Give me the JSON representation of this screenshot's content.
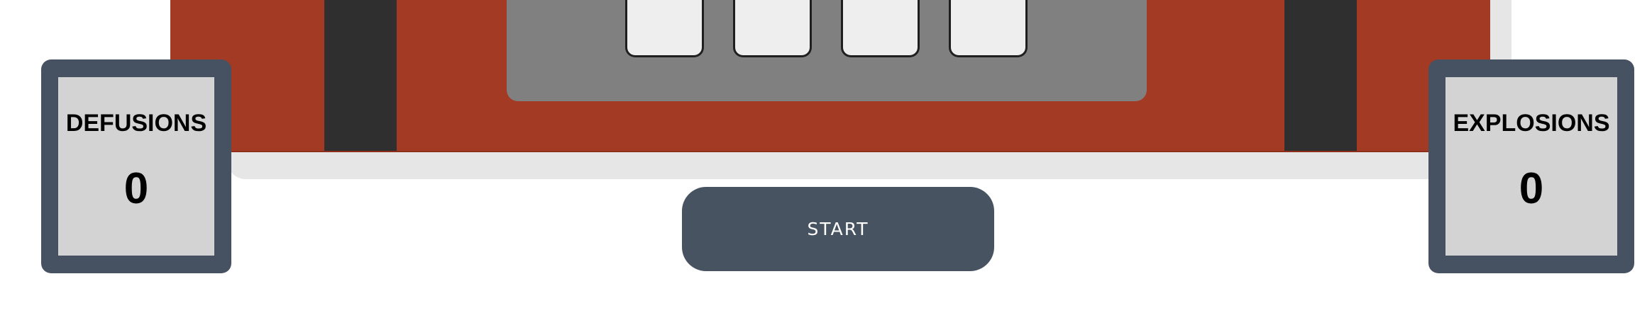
{
  "colors": {
    "bomb_red": "#a33a24",
    "strap_dark": "#2e2f2e",
    "keypad_gray": "#808080",
    "key_white": "#eeeeee",
    "panel_slate": "#465262",
    "panel_inner": "#d3d3d3",
    "button_slate": "#485362",
    "shadow_gray": "#e6e6e6"
  },
  "scoreboard": {
    "defusions": {
      "label": "DEFUSIONS",
      "value": "0"
    },
    "explosions": {
      "label": "EXPLOSIONS",
      "value": "0"
    }
  },
  "controls": {
    "start_label": "START"
  }
}
